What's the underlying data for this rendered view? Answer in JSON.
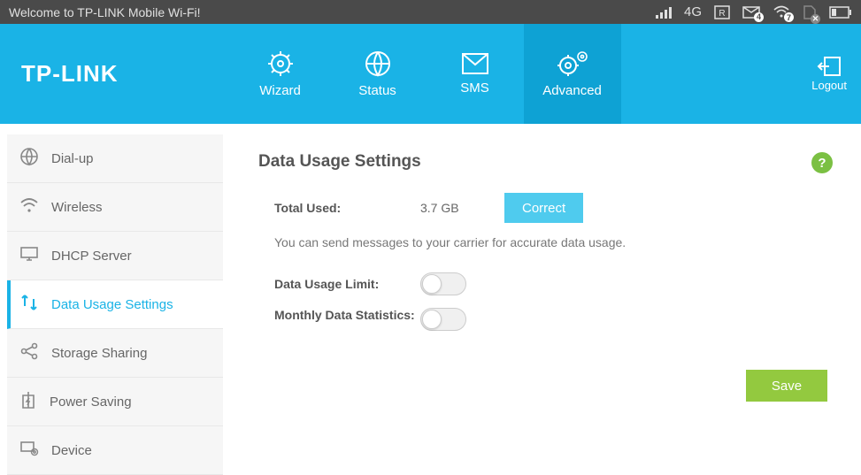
{
  "status_bar": {
    "welcome": "Welcome to TP-LINK Mobile Wi-Fi!",
    "network_type": "4G",
    "sms_count": "4",
    "wifi_count": "7"
  },
  "brand": "TP-LINK",
  "nav": {
    "wizard": "Wizard",
    "status": "Status",
    "sms": "SMS",
    "advanced": "Advanced",
    "logout": "Logout"
  },
  "sidebar": {
    "items": [
      {
        "label": "Dial-up"
      },
      {
        "label": "Wireless"
      },
      {
        "label": "DHCP Server"
      },
      {
        "label": "Data Usage Settings"
      },
      {
        "label": "Storage Sharing"
      },
      {
        "label": "Power Saving"
      },
      {
        "label": "Device"
      }
    ],
    "active_index": 3
  },
  "page": {
    "title": "Data Usage Settings",
    "help": "?",
    "total_used_label": "Total Used:",
    "total_used_value": "3.7 GB",
    "correct_label": "Correct",
    "hint": "You can send messages to your carrier for accurate data usage.",
    "limit_label": "Data Usage Limit:",
    "monthly_label": "Monthly Data Statistics:",
    "save_label": "Save",
    "limit_on": false,
    "monthly_on": false
  }
}
